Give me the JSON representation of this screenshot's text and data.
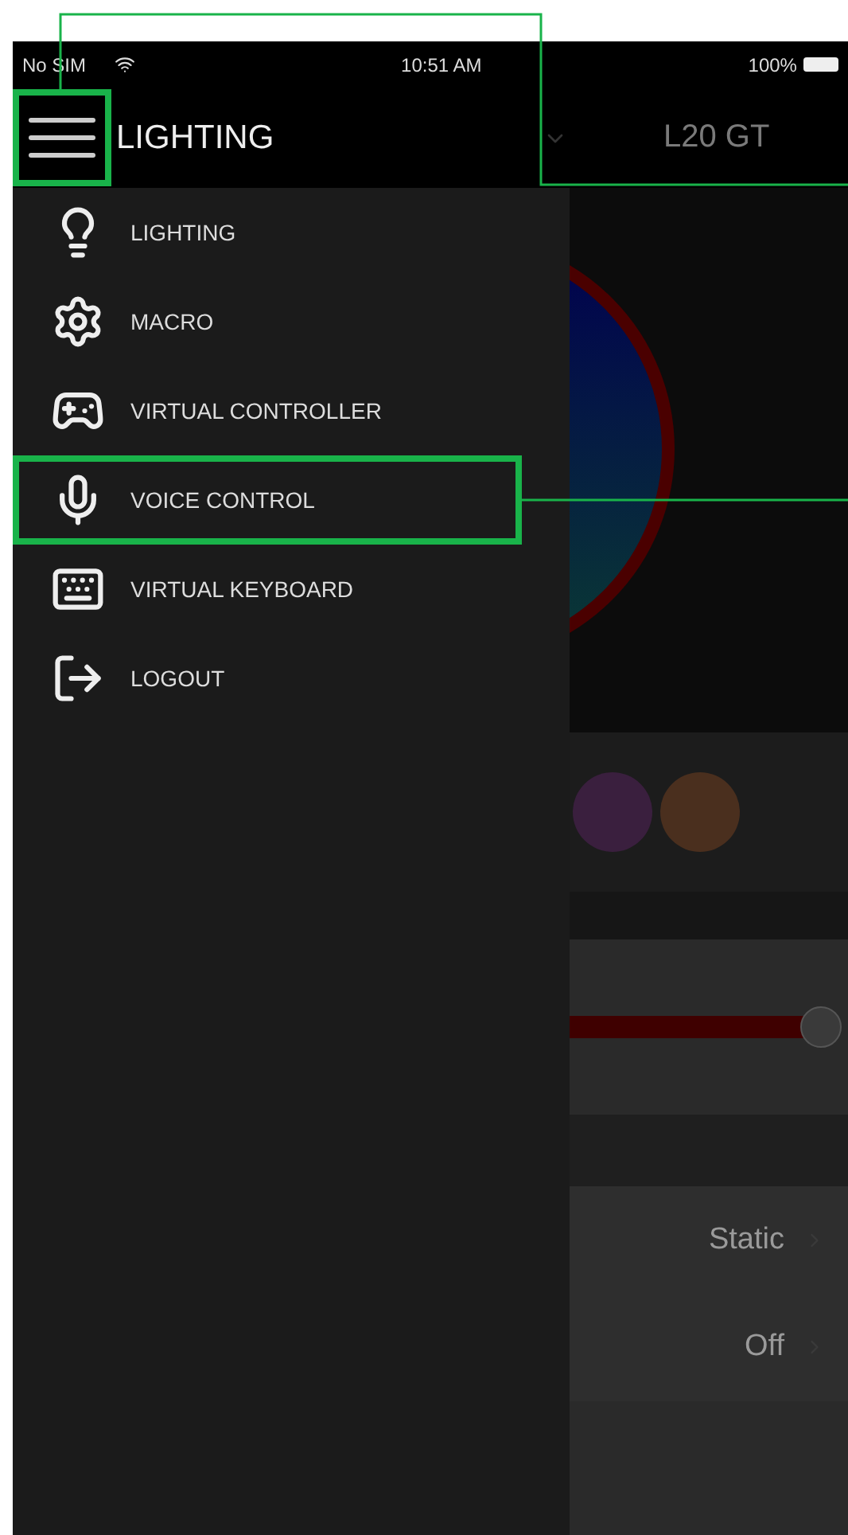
{
  "status_bar": {
    "carrier": "No SIM",
    "time": "10:51 AM",
    "battery": "100%"
  },
  "header": {
    "title": "LIGHTING",
    "device": "L20 GT",
    "menu_highlighted": true
  },
  "drawer": {
    "items": [
      {
        "label": "LIGHTING",
        "highlighted": false
      },
      {
        "label": "MACRO",
        "highlighted": false
      },
      {
        "label": "VIRTUAL CONTROLLER",
        "highlighted": false
      },
      {
        "label": "VOICE CONTROL",
        "highlighted": true
      },
      {
        "label": "VIRTUAL KEYBOARD",
        "highlighted": false
      },
      {
        "label": "LOGOUT",
        "highlighted": false
      }
    ]
  },
  "background": {
    "swatches": [
      {
        "color": "#3a1f3e"
      },
      {
        "color": "#4a2f1e"
      }
    ],
    "slider": {
      "level": 0.9
    },
    "rows": [
      {
        "value": "Static"
      },
      {
        "value": "Off"
      }
    ]
  }
}
